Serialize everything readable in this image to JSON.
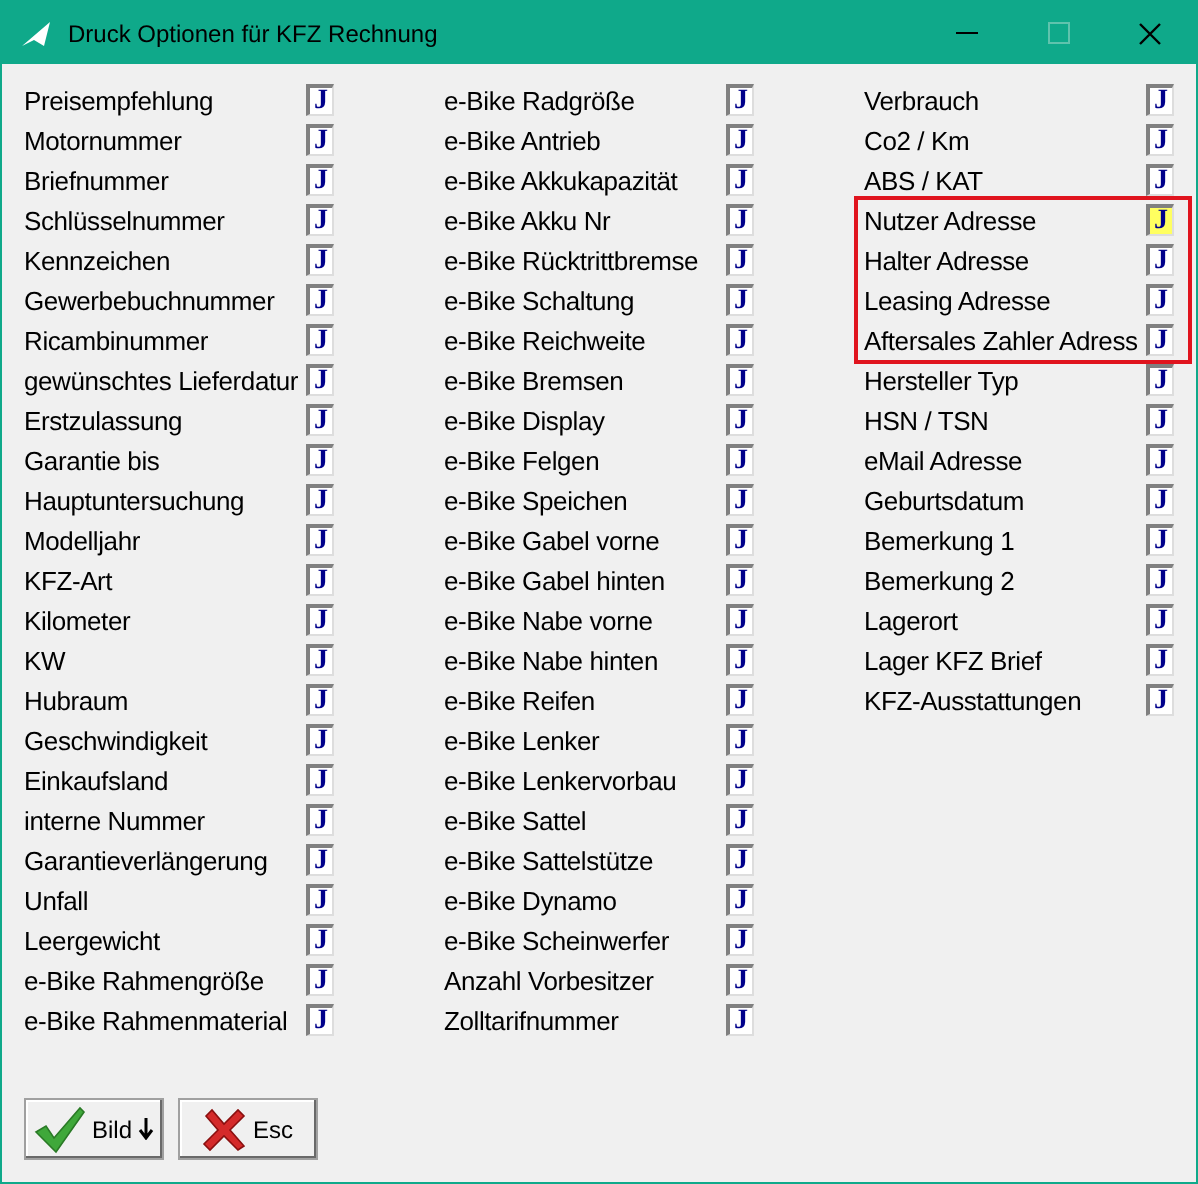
{
  "window": {
    "title": "Druck Optionen für KFZ Rechnung"
  },
  "columns": [
    {
      "fields": [
        {
          "label": "Preisempfehlung",
          "value": "J",
          "focused": false,
          "marked": false
        },
        {
          "label": "Motornummer",
          "value": "J",
          "focused": false,
          "marked": false
        },
        {
          "label": "Briefnummer",
          "value": "J",
          "focused": false,
          "marked": false
        },
        {
          "label": "Schlüsselnummer",
          "value": "J",
          "focused": false,
          "marked": false
        },
        {
          "label": "Kennzeichen",
          "value": "J",
          "focused": false,
          "marked": false
        },
        {
          "label": "Gewerbebuchnummer",
          "value": "J",
          "focused": false,
          "marked": false
        },
        {
          "label": "Ricambinummer",
          "value": "J",
          "focused": false,
          "marked": false
        },
        {
          "label": "gewünschtes Lieferdatur",
          "value": "J",
          "focused": false,
          "marked": false
        },
        {
          "label": "Erstzulassung",
          "value": "J",
          "focused": false,
          "marked": false
        },
        {
          "label": "Garantie bis",
          "value": "J",
          "focused": false,
          "marked": false
        },
        {
          "label": "Hauptuntersuchung",
          "value": "J",
          "focused": false,
          "marked": false
        },
        {
          "label": "Modelljahr",
          "value": "J",
          "focused": false,
          "marked": false
        },
        {
          "label": "KFZ-Art",
          "value": "J",
          "focused": false,
          "marked": false
        },
        {
          "label": "Kilometer",
          "value": "J",
          "focused": false,
          "marked": false
        },
        {
          "label": "KW",
          "value": "J",
          "focused": false,
          "marked": false
        },
        {
          "label": "Hubraum",
          "value": "J",
          "focused": false,
          "marked": false
        },
        {
          "label": "Geschwindigkeit",
          "value": "J",
          "focused": false,
          "marked": false
        },
        {
          "label": "Einkaufsland",
          "value": "J",
          "focused": false,
          "marked": false
        },
        {
          "label": "interne Nummer",
          "value": "J",
          "focused": false,
          "marked": false
        },
        {
          "label": "Garantieverlängerung",
          "value": "J",
          "focused": false,
          "marked": false
        },
        {
          "label": "Unfall",
          "value": "J",
          "focused": false,
          "marked": false
        },
        {
          "label": "Leergewicht",
          "value": "J",
          "focused": false,
          "marked": false
        },
        {
          "label": "e-Bike Rahmengröße",
          "value": "J",
          "focused": false,
          "marked": false
        },
        {
          "label": "e-Bike Rahmenmaterial",
          "value": "J",
          "focused": false,
          "marked": false
        }
      ]
    },
    {
      "fields": [
        {
          "label": "e-Bike Radgröße",
          "value": "J",
          "focused": false,
          "marked": false
        },
        {
          "label": "e-Bike Antrieb",
          "value": "J",
          "focused": false,
          "marked": false
        },
        {
          "label": "e-Bike Akkukapazität",
          "value": "J",
          "focused": false,
          "marked": false
        },
        {
          "label": "e-Bike Akku Nr",
          "value": "J",
          "focused": false,
          "marked": false
        },
        {
          "label": "e-Bike Rücktrittbremse",
          "value": "J",
          "focused": false,
          "marked": false
        },
        {
          "label": "e-Bike Schaltung",
          "value": "J",
          "focused": false,
          "marked": false
        },
        {
          "label": "e-Bike Reichweite",
          "value": "J",
          "focused": false,
          "marked": false
        },
        {
          "label": "e-Bike Bremsen",
          "value": "J",
          "focused": false,
          "marked": false
        },
        {
          "label": "e-Bike Display",
          "value": "J",
          "focused": false,
          "marked": false
        },
        {
          "label": "e-Bike Felgen",
          "value": "J",
          "focused": false,
          "marked": false
        },
        {
          "label": "e-Bike Speichen",
          "value": "J",
          "focused": false,
          "marked": false
        },
        {
          "label": "e-Bike Gabel vorne",
          "value": "J",
          "focused": false,
          "marked": false
        },
        {
          "label": "e-Bike Gabel hinten",
          "value": "J",
          "focused": false,
          "marked": false
        },
        {
          "label": "e-Bike Nabe vorne",
          "value": "J",
          "focused": false,
          "marked": false
        },
        {
          "label": "e-Bike Nabe hinten",
          "value": "J",
          "focused": false,
          "marked": false
        },
        {
          "label": "e-Bike Reifen",
          "value": "J",
          "focused": false,
          "marked": false
        },
        {
          "label": "e-Bike Lenker",
          "value": "J",
          "focused": false,
          "marked": false
        },
        {
          "label": "e-Bike Lenkervorbau",
          "value": "J",
          "focused": false,
          "marked": false
        },
        {
          "label": "e-Bike Sattel",
          "value": "J",
          "focused": false,
          "marked": false
        },
        {
          "label": "e-Bike Sattelstütze",
          "value": "J",
          "focused": false,
          "marked": false
        },
        {
          "label": "e-Bike Dynamo",
          "value": "J",
          "focused": false,
          "marked": false
        },
        {
          "label": "e-Bike Scheinwerfer",
          "value": "J",
          "focused": false,
          "marked": false
        },
        {
          "label": "Anzahl Vorbesitzer",
          "value": "J",
          "focused": false,
          "marked": false
        },
        {
          "label": "Zolltarifnummer",
          "value": "J",
          "focused": false,
          "marked": false
        }
      ]
    },
    {
      "fields": [
        {
          "label": "Verbrauch",
          "value": "J",
          "focused": false,
          "marked": false
        },
        {
          "label": "Co2 / Km",
          "value": "J",
          "focused": false,
          "marked": false
        },
        {
          "label": "ABS / KAT",
          "value": "J",
          "focused": false,
          "marked": false
        },
        {
          "label": "Nutzer Adresse",
          "value": "J",
          "focused": true,
          "marked": true
        },
        {
          "label": "Halter Adresse",
          "value": "J",
          "focused": false,
          "marked": true
        },
        {
          "label": "Leasing Adresse",
          "value": "J",
          "focused": false,
          "marked": true
        },
        {
          "label": "Aftersales Zahler Adress",
          "value": "J",
          "focused": false,
          "marked": true
        },
        {
          "label": "Hersteller Typ",
          "value": "J",
          "focused": false,
          "marked": false
        },
        {
          "label": "HSN / TSN",
          "value": "J",
          "focused": false,
          "marked": false
        },
        {
          "label": "eMail Adresse",
          "value": "J",
          "focused": false,
          "marked": false
        },
        {
          "label": "Geburtsdatum",
          "value": "J",
          "focused": false,
          "marked": false
        },
        {
          "label": "Bemerkung 1",
          "value": "J",
          "focused": false,
          "marked": false
        },
        {
          "label": "Bemerkung 2",
          "value": "J",
          "focused": false,
          "marked": false
        },
        {
          "label": "Lagerort",
          "value": "J",
          "focused": false,
          "marked": false
        },
        {
          "label": "Lager KFZ Brief",
          "value": "J",
          "focused": false,
          "marked": false
        },
        {
          "label": "KFZ-Ausstattungen",
          "value": "J",
          "focused": false,
          "marked": false
        }
      ]
    }
  ],
  "buttons": [
    {
      "kind": "ok",
      "label": "Bild"
    },
    {
      "kind": "cancel",
      "label": "Esc"
    }
  ]
}
